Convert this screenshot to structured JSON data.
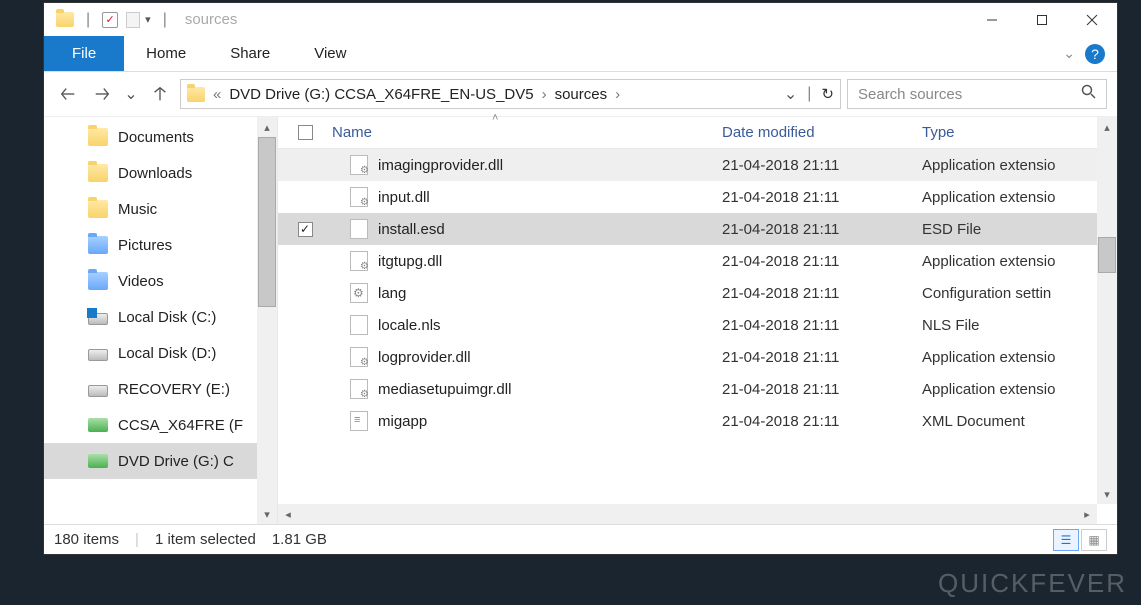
{
  "titlebar": {
    "title": "sources"
  },
  "ribbon": {
    "file": "File",
    "tabs": [
      "Home",
      "Share",
      "View"
    ]
  },
  "breadcrumb": {
    "prefix": "«",
    "parts": [
      "DVD Drive (G:) CCSA_X64FRE_EN-US_DV5",
      "sources"
    ]
  },
  "search": {
    "placeholder": "Search sources"
  },
  "nav": {
    "items": [
      {
        "label": "Documents",
        "icon": "folder"
      },
      {
        "label": "Downloads",
        "icon": "folder"
      },
      {
        "label": "Music",
        "icon": "folder"
      },
      {
        "label": "Pictures",
        "icon": "folder-blue"
      },
      {
        "label": "Videos",
        "icon": "folder-blue"
      },
      {
        "label": "Local Disk (C:)",
        "icon": "disk-c"
      },
      {
        "label": "Local Disk (D:)",
        "icon": "disk"
      },
      {
        "label": "RECOVERY (E:)",
        "icon": "disk"
      },
      {
        "label": "CCSA_X64FRE (F",
        "icon": "dvd"
      },
      {
        "label": "DVD Drive (G:) C",
        "icon": "dvd",
        "selected": true
      }
    ]
  },
  "columns": {
    "name": "Name",
    "date": "Date modified",
    "type": "Type"
  },
  "files": [
    {
      "name": "imagingprovider.dll",
      "date": "21-04-2018 21:11",
      "type": "Application extensio",
      "icon": "cog",
      "partial": true
    },
    {
      "name": "input.dll",
      "date": "21-04-2018 21:11",
      "type": "Application extensio",
      "icon": "cog"
    },
    {
      "name": "install.esd",
      "date": "21-04-2018 21:11",
      "type": "ESD File",
      "icon": "plain",
      "selected": true,
      "checked": true
    },
    {
      "name": "itgtupg.dll",
      "date": "21-04-2018 21:11",
      "type": "Application extensio",
      "icon": "cog"
    },
    {
      "name": "lang",
      "date": "21-04-2018 21:11",
      "type": "Configuration settin",
      "icon": "cfg"
    },
    {
      "name": "locale.nls",
      "date": "21-04-2018 21:11",
      "type": "NLS File",
      "icon": "plain"
    },
    {
      "name": "logprovider.dll",
      "date": "21-04-2018 21:11",
      "type": "Application extensio",
      "icon": "cog"
    },
    {
      "name": "mediasetupuimgr.dll",
      "date": "21-04-2018 21:11",
      "type": "Application extensio",
      "icon": "cog"
    },
    {
      "name": "migapp",
      "date": "21-04-2018 21:11",
      "type": "XML Document",
      "icon": "xml"
    }
  ],
  "status": {
    "items": "180 items",
    "selection": "1 item selected",
    "size": "1.81 GB"
  },
  "watermark": "QUICKFEVER"
}
